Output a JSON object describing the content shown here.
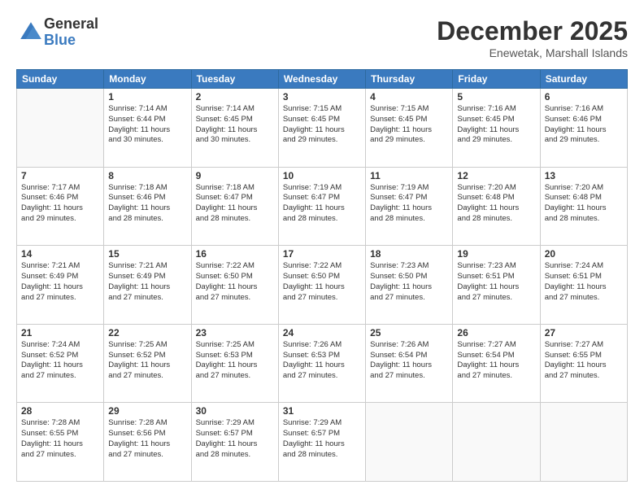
{
  "header": {
    "logo": {
      "line1": "General",
      "line2": "Blue"
    },
    "title": "December 2025",
    "location": "Enewetak, Marshall Islands"
  },
  "weekdays": [
    "Sunday",
    "Monday",
    "Tuesday",
    "Wednesday",
    "Thursday",
    "Friday",
    "Saturday"
  ],
  "weeks": [
    [
      {
        "day": "",
        "info": ""
      },
      {
        "day": "1",
        "info": "Sunrise: 7:14 AM\nSunset: 6:44 PM\nDaylight: 11 hours\nand 30 minutes."
      },
      {
        "day": "2",
        "info": "Sunrise: 7:14 AM\nSunset: 6:45 PM\nDaylight: 11 hours\nand 30 minutes."
      },
      {
        "day": "3",
        "info": "Sunrise: 7:15 AM\nSunset: 6:45 PM\nDaylight: 11 hours\nand 29 minutes."
      },
      {
        "day": "4",
        "info": "Sunrise: 7:15 AM\nSunset: 6:45 PM\nDaylight: 11 hours\nand 29 minutes."
      },
      {
        "day": "5",
        "info": "Sunrise: 7:16 AM\nSunset: 6:45 PM\nDaylight: 11 hours\nand 29 minutes."
      },
      {
        "day": "6",
        "info": "Sunrise: 7:16 AM\nSunset: 6:46 PM\nDaylight: 11 hours\nand 29 minutes."
      }
    ],
    [
      {
        "day": "7",
        "info": "Sunrise: 7:17 AM\nSunset: 6:46 PM\nDaylight: 11 hours\nand 29 minutes."
      },
      {
        "day": "8",
        "info": "Sunrise: 7:18 AM\nSunset: 6:46 PM\nDaylight: 11 hours\nand 28 minutes."
      },
      {
        "day": "9",
        "info": "Sunrise: 7:18 AM\nSunset: 6:47 PM\nDaylight: 11 hours\nand 28 minutes."
      },
      {
        "day": "10",
        "info": "Sunrise: 7:19 AM\nSunset: 6:47 PM\nDaylight: 11 hours\nand 28 minutes."
      },
      {
        "day": "11",
        "info": "Sunrise: 7:19 AM\nSunset: 6:47 PM\nDaylight: 11 hours\nand 28 minutes."
      },
      {
        "day": "12",
        "info": "Sunrise: 7:20 AM\nSunset: 6:48 PM\nDaylight: 11 hours\nand 28 minutes."
      },
      {
        "day": "13",
        "info": "Sunrise: 7:20 AM\nSunset: 6:48 PM\nDaylight: 11 hours\nand 28 minutes."
      }
    ],
    [
      {
        "day": "14",
        "info": "Sunrise: 7:21 AM\nSunset: 6:49 PM\nDaylight: 11 hours\nand 27 minutes."
      },
      {
        "day": "15",
        "info": "Sunrise: 7:21 AM\nSunset: 6:49 PM\nDaylight: 11 hours\nand 27 minutes."
      },
      {
        "day": "16",
        "info": "Sunrise: 7:22 AM\nSunset: 6:50 PM\nDaylight: 11 hours\nand 27 minutes."
      },
      {
        "day": "17",
        "info": "Sunrise: 7:22 AM\nSunset: 6:50 PM\nDaylight: 11 hours\nand 27 minutes."
      },
      {
        "day": "18",
        "info": "Sunrise: 7:23 AM\nSunset: 6:50 PM\nDaylight: 11 hours\nand 27 minutes."
      },
      {
        "day": "19",
        "info": "Sunrise: 7:23 AM\nSunset: 6:51 PM\nDaylight: 11 hours\nand 27 minutes."
      },
      {
        "day": "20",
        "info": "Sunrise: 7:24 AM\nSunset: 6:51 PM\nDaylight: 11 hours\nand 27 minutes."
      }
    ],
    [
      {
        "day": "21",
        "info": "Sunrise: 7:24 AM\nSunset: 6:52 PM\nDaylight: 11 hours\nand 27 minutes."
      },
      {
        "day": "22",
        "info": "Sunrise: 7:25 AM\nSunset: 6:52 PM\nDaylight: 11 hours\nand 27 minutes."
      },
      {
        "day": "23",
        "info": "Sunrise: 7:25 AM\nSunset: 6:53 PM\nDaylight: 11 hours\nand 27 minutes."
      },
      {
        "day": "24",
        "info": "Sunrise: 7:26 AM\nSunset: 6:53 PM\nDaylight: 11 hours\nand 27 minutes."
      },
      {
        "day": "25",
        "info": "Sunrise: 7:26 AM\nSunset: 6:54 PM\nDaylight: 11 hours\nand 27 minutes."
      },
      {
        "day": "26",
        "info": "Sunrise: 7:27 AM\nSunset: 6:54 PM\nDaylight: 11 hours\nand 27 minutes."
      },
      {
        "day": "27",
        "info": "Sunrise: 7:27 AM\nSunset: 6:55 PM\nDaylight: 11 hours\nand 27 minutes."
      }
    ],
    [
      {
        "day": "28",
        "info": "Sunrise: 7:28 AM\nSunset: 6:55 PM\nDaylight: 11 hours\nand 27 minutes."
      },
      {
        "day": "29",
        "info": "Sunrise: 7:28 AM\nSunset: 6:56 PM\nDaylight: 11 hours\nand 27 minutes."
      },
      {
        "day": "30",
        "info": "Sunrise: 7:29 AM\nSunset: 6:57 PM\nDaylight: 11 hours\nand 28 minutes."
      },
      {
        "day": "31",
        "info": "Sunrise: 7:29 AM\nSunset: 6:57 PM\nDaylight: 11 hours\nand 28 minutes."
      },
      {
        "day": "",
        "info": ""
      },
      {
        "day": "",
        "info": ""
      },
      {
        "day": "",
        "info": ""
      }
    ]
  ]
}
